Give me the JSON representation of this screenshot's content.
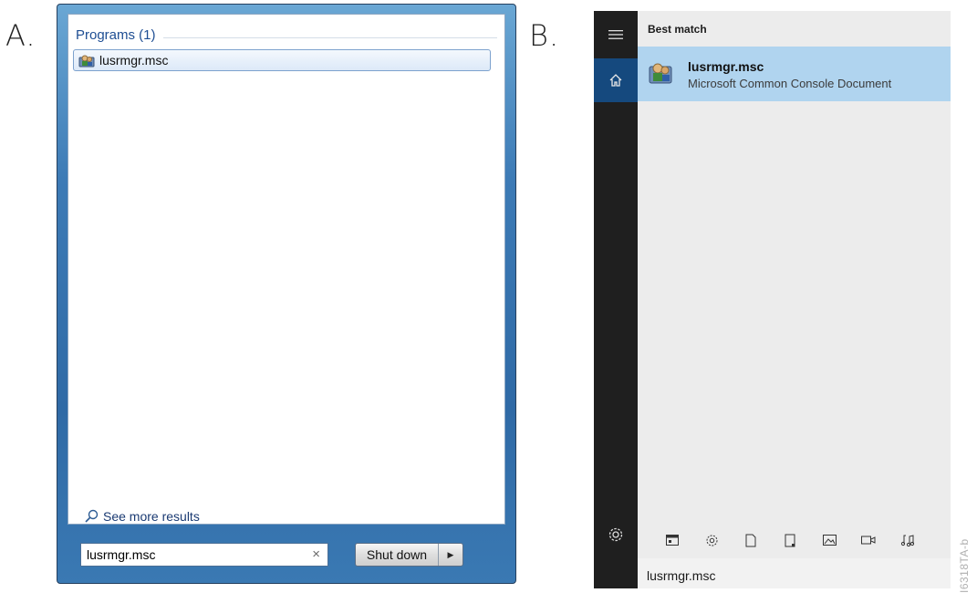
{
  "panels": {
    "a_label": "A.",
    "b_label": "B."
  },
  "win7": {
    "group_title": "Programs (1)",
    "result_label": "lusrmgr.msc",
    "see_more": "See more results",
    "search_value": "lusrmgr.msc",
    "clear_glyph": "×",
    "shutdown_label": "Shut down",
    "shutdown_arrow": "▶"
  },
  "win10": {
    "best_match": "Best match",
    "result_title": "lusrmgr.msc",
    "result_subtitle": "Microsoft Common Console Document",
    "search_value": "lusrmgr.msc",
    "filter_icons": [
      "apps-icon",
      "settings-icon",
      "documents-icon",
      "folders-icon",
      "photos-icon",
      "videos-icon",
      "music-icon"
    ],
    "accent": "#15497e",
    "highlight": "#b0d4ef"
  },
  "figure_code": "I6318TA-b"
}
